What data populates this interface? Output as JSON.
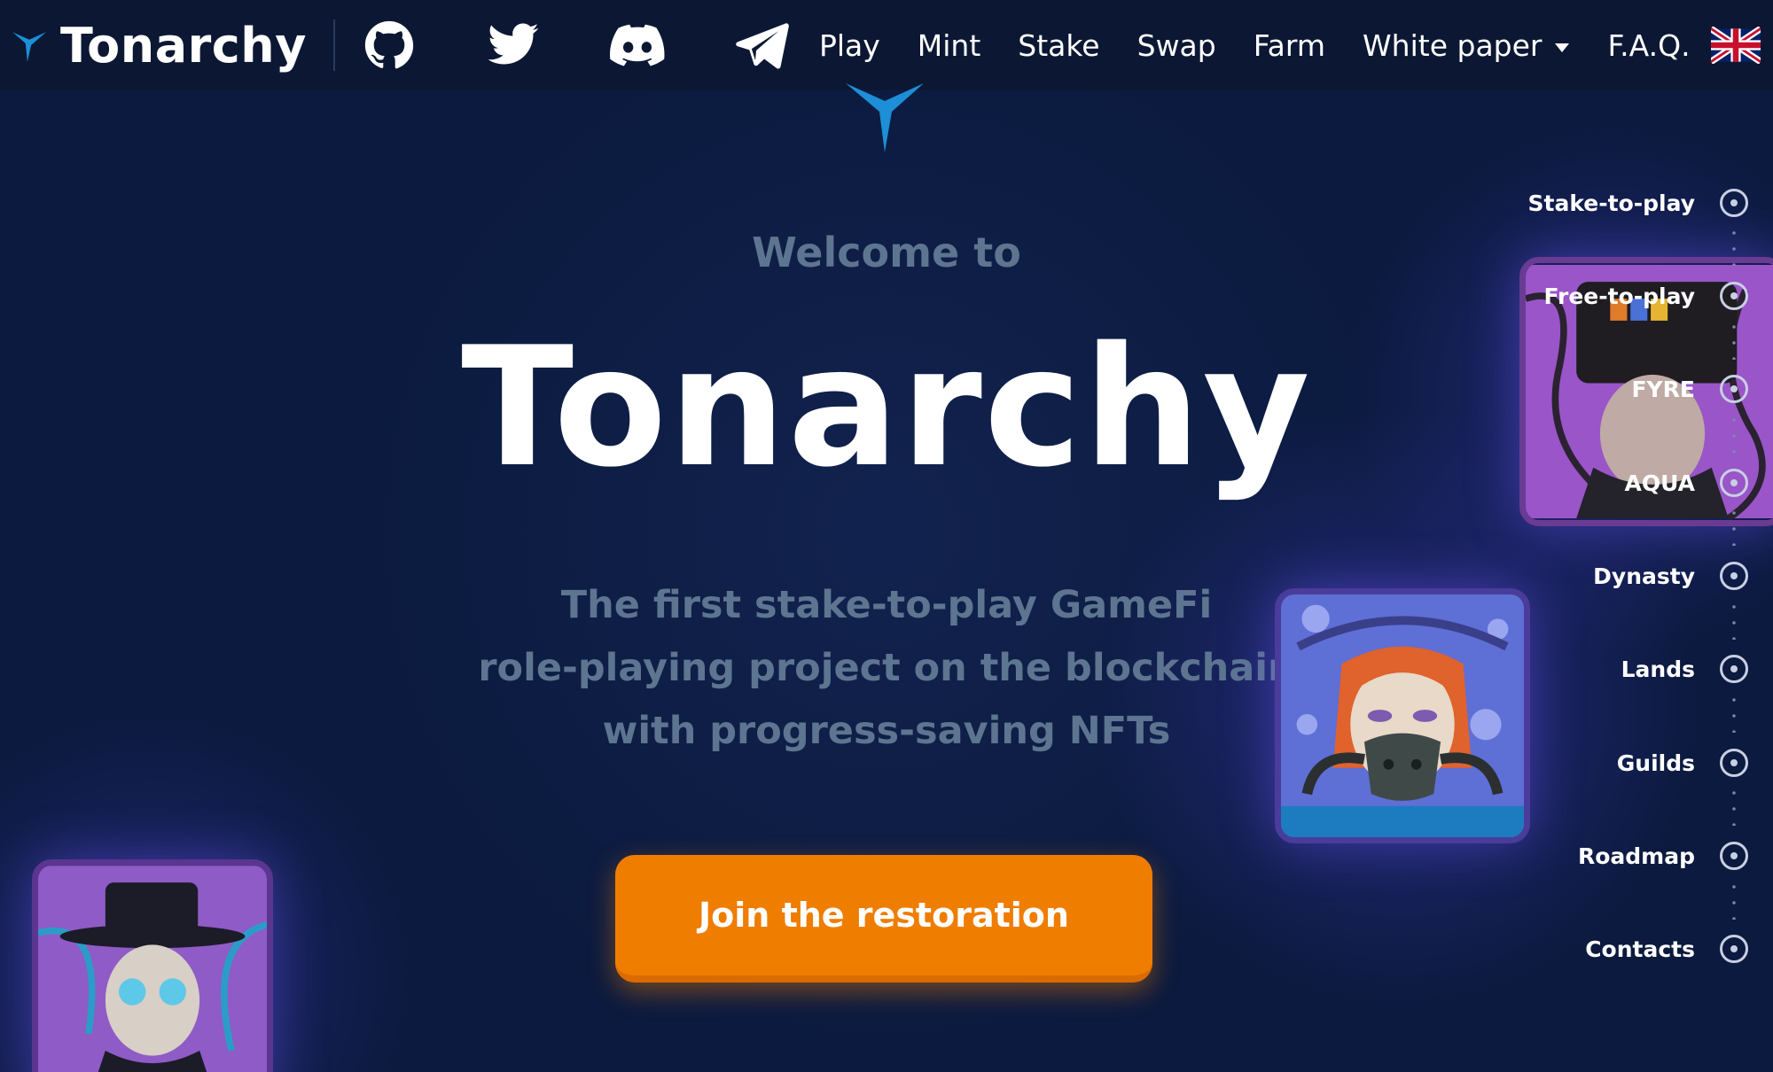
{
  "brand": {
    "name": "Tonarchy",
    "logo_icon": "tonarchy-bird-logo-icon",
    "accent": "#1d8fd6"
  },
  "social": [
    {
      "name": "github",
      "icon": "github-icon"
    },
    {
      "name": "twitter",
      "icon": "twitter-icon"
    },
    {
      "name": "discord",
      "icon": "discord-icon"
    },
    {
      "name": "telegram",
      "icon": "telegram-icon"
    }
  ],
  "nav": {
    "items": [
      "Play",
      "Mint",
      "Stake",
      "Swap",
      "Farm",
      "White paper",
      "F.A.Q."
    ],
    "dropdown_item": "White paper",
    "language_icon": "uk-flag-icon"
  },
  "hero": {
    "welcome": "Welcome to",
    "title": "Tonarchy",
    "subtitle_lines": [
      "The first stake-to-play GameFi",
      "role-playing project on the blockchain",
      "with progress-saving NFTs"
    ],
    "cta": "Join the restoration",
    "cta_color": "#ef7d00"
  },
  "sections": {
    "items": [
      "Stake-to-play",
      "Free-to-play",
      "FYRE",
      "AQUA",
      "Dynasty",
      "Lands",
      "Guilds",
      "Roadmap",
      "Contacts"
    ]
  },
  "cards": [
    "nft-vr-character",
    "nft-gasmask-character",
    "nft-hat-character"
  ],
  "colors": {
    "background": "#0b1a3e",
    "navbar": "#0c1833",
    "muted_text": "#5d7590"
  }
}
